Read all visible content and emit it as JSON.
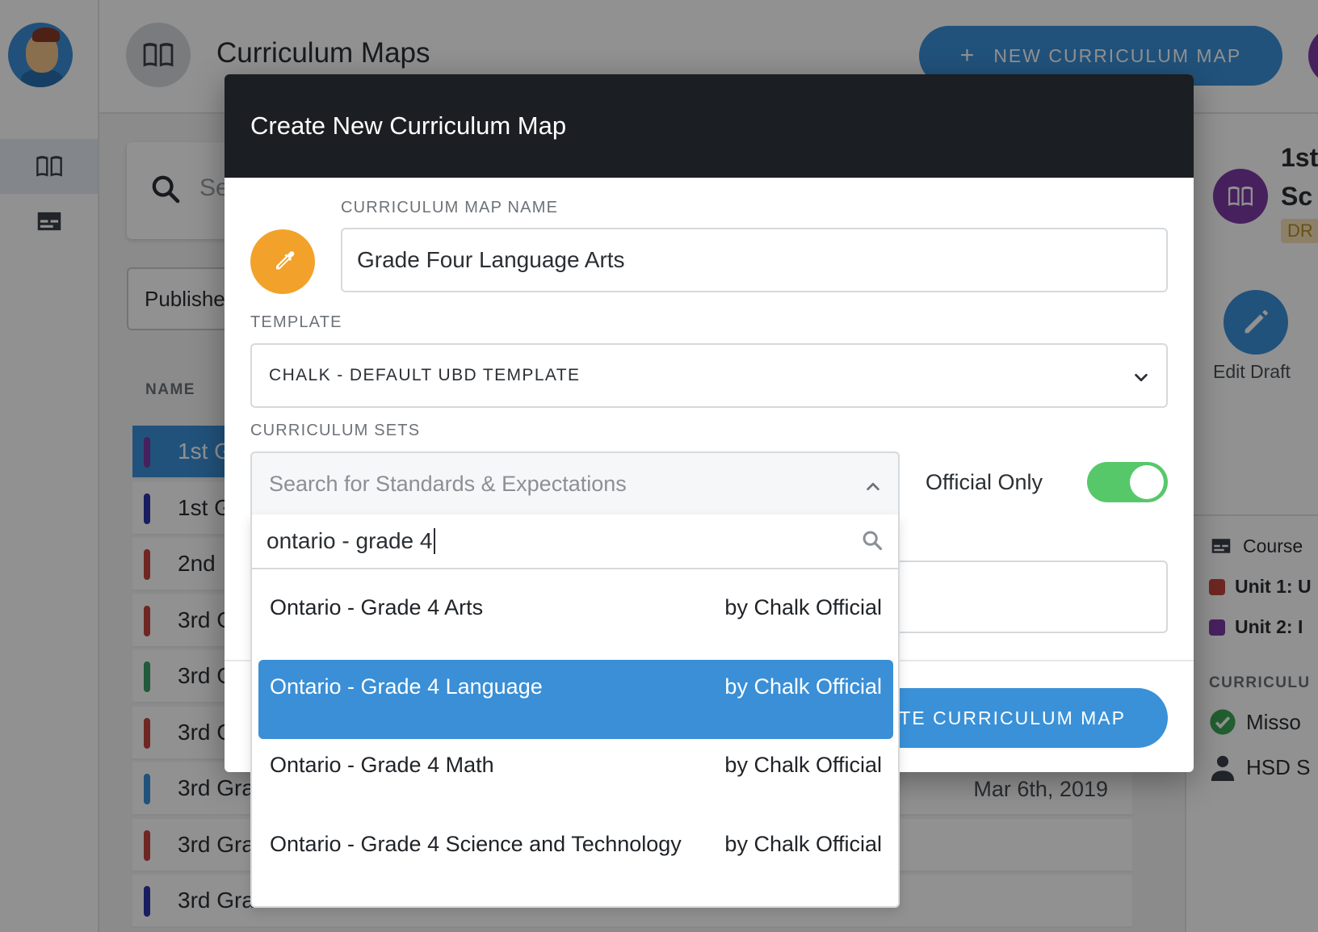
{
  "app": {
    "page_title": "Curriculum Maps",
    "new_map_button": "NEW CURRICULUM MAP",
    "search_placeholder": "Se",
    "filter_value": "Publishe",
    "table_header_name": "NAME",
    "rows": [
      {
        "name": "1st G",
        "color": "#7d3aa6",
        "selected": true,
        "date": ""
      },
      {
        "name": "1st G",
        "color": "#2b35a8",
        "selected": false,
        "date": ""
      },
      {
        "name": "2nd",
        "color": "#c2463e",
        "selected": false,
        "date": ""
      },
      {
        "name": "3rd G",
        "color": "#c2463e",
        "selected": false,
        "date": ""
      },
      {
        "name": "3rd G",
        "color": "#3a9e6a",
        "selected": false,
        "date": ""
      },
      {
        "name": "3rd G",
        "color": "#c2463e",
        "selected": false,
        "date": ""
      },
      {
        "name": "3rd Gra",
        "color": "#3a91d8",
        "selected": false,
        "date": "Mar 6th, 2019"
      },
      {
        "name": "3rd Gra",
        "color": "#c2463e",
        "selected": false,
        "date": ""
      },
      {
        "name": "3rd Gra",
        "color": "#2b35a8",
        "selected": false,
        "date": ""
      }
    ]
  },
  "right_panel": {
    "title_line1": "1st",
    "title_line2": "Sc",
    "status_badge": "DR",
    "edit_label": "Edit Draft",
    "course_label": "Course",
    "unit1": "Unit 1: U",
    "unit2": "Unit 2: I",
    "section_label": "CURRICULU",
    "item1": "Misso",
    "item2": "HSD S"
  },
  "modal": {
    "title": "Create New Curriculum Map",
    "name_label": "CURRICULUM MAP NAME",
    "name_value": "Grade Four Language Arts",
    "template_label": "TEMPLATE",
    "template_value": "CHALK - DEFAULT UBD TEMPLATE",
    "sets_label": "CURRICULUM SETS",
    "sets_placeholder": "Search for Standards & Expectations",
    "official_only_label": "Official Only",
    "official_only_on": true,
    "create_button": "CREATE CURRICULUM MAP",
    "accent_color": "#f2a22a"
  },
  "dropdown": {
    "query": "ontario - grade 4",
    "options": [
      {
        "name": "Ontario - Grade 4 Arts",
        "by": "by Chalk Official",
        "highlighted": false
      },
      {
        "name": "Ontario - Grade 4 Language",
        "by": "by Chalk Official",
        "highlighted": true
      },
      {
        "name": "Ontario - Grade 4 Math",
        "by": "by Chalk Official",
        "highlighted": false
      },
      {
        "name": "Ontario - Grade 4 Science and Technology",
        "by": "by Chalk Official",
        "highlighted": false
      }
    ]
  }
}
